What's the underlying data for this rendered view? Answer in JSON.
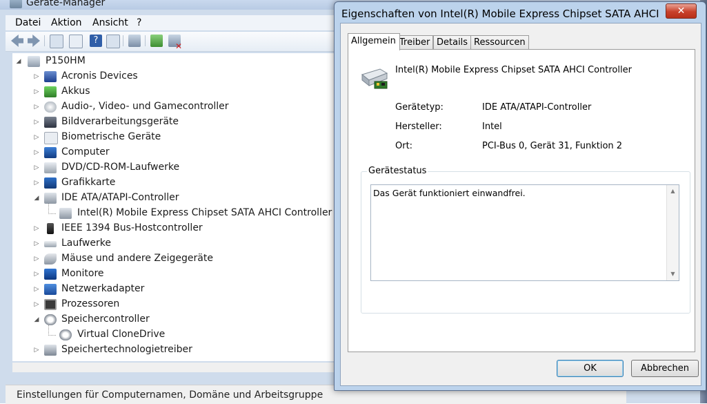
{
  "devmgr": {
    "title": "Geräte-Manager",
    "menu": [
      "Datei",
      "Aktion",
      "Ansicht",
      "?"
    ],
    "tree": {
      "root": "P150HM",
      "nodes": [
        {
          "label": "Acronis Devices",
          "expanded": false
        },
        {
          "label": "Akkus",
          "expanded": false
        },
        {
          "label": "Audio-, Video- und Gamecontroller",
          "expanded": false
        },
        {
          "label": "Bildverarbeitungsgeräte",
          "expanded": false
        },
        {
          "label": "Biometrische Geräte",
          "expanded": false
        },
        {
          "label": "Computer",
          "expanded": false
        },
        {
          "label": "DVD/CD-ROM-Laufwerke",
          "expanded": false
        },
        {
          "label": "Grafikkarte",
          "expanded": false
        },
        {
          "label": "IDE ATA/ATAPI-Controller",
          "expanded": true,
          "child": "Intel(R) Mobile Express Chipset SATA AHCI Controller"
        },
        {
          "label": "IEEE 1394 Bus-Hostcontroller",
          "expanded": false
        },
        {
          "label": "Laufwerke",
          "expanded": false
        },
        {
          "label": "Mäuse und andere Zeigegeräte",
          "expanded": false
        },
        {
          "label": "Monitore",
          "expanded": false
        },
        {
          "label": "Netzwerkadapter",
          "expanded": false
        },
        {
          "label": "Prozessoren",
          "expanded": false
        },
        {
          "label": "Speichercontroller",
          "expanded": true,
          "child": "Virtual CloneDrive"
        },
        {
          "label": "Speichertechnologietreiber",
          "expanded": false
        }
      ]
    },
    "status": "Einstellungen für Computernamen, Domäne und Arbeitsgruppe"
  },
  "dialog": {
    "title": "Eigenschaften von Intel(R) Mobile Express Chipset SATA AHCI Controll...",
    "close": "✕",
    "tabs": [
      "Allgemein",
      "Treiber",
      "Details",
      "Ressourcen"
    ],
    "active_tab": "Allgemein",
    "device_name": "Intel(R) Mobile Express Chipset SATA AHCI Controller",
    "props": {
      "type_label": "Gerätetyp:",
      "type_value": "IDE ATA/ATAPI-Controller",
      "maker_label": "Hersteller:",
      "maker_value": "Intel",
      "loc_label": "Ort:",
      "loc_value": "PCI-Bus 0, Gerät 31, Funktion 2"
    },
    "status_group_title": "Gerätestatus",
    "status_text": "Das Gerät funktioniert einwandfrei.",
    "ok": "OK",
    "cancel": "Abbrechen"
  }
}
